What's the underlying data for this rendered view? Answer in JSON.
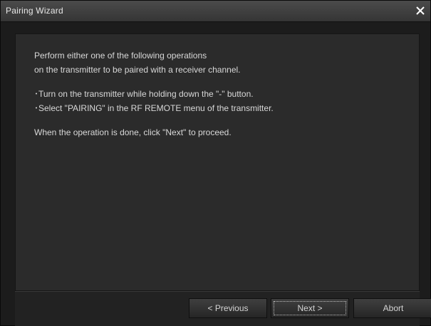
{
  "window": {
    "title": "Pairing Wizard"
  },
  "content": {
    "line1": "Perform either one of the following operations",
    "line2": "on the transmitter to be paired with a receiver channel.",
    "bullet1": "･Turn on the transmitter while holding down the \"-\" button.",
    "bullet2": "･Select \"PAIRING\" in the RF REMOTE menu of the transmitter.",
    "instruction": "When the operation is done, click \"Next\" to proceed."
  },
  "buttons": {
    "previous": "< Previous",
    "next": "Next >",
    "abort": "Abort"
  },
  "colors": {
    "window_bg": "#1c1c1c",
    "panel_bg": "#2b2b2b",
    "text": "#d8d8d8"
  }
}
